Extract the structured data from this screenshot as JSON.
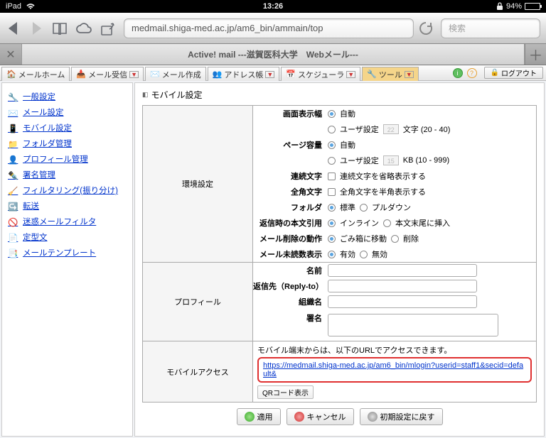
{
  "ios": {
    "device": "iPad",
    "time": "13:26",
    "battery": "94%"
  },
  "browser": {
    "url": "medmail.shiga-med.ac.jp/am6_bin/ammain/top",
    "searchPlaceholder": "検索",
    "tab": "Active! mail ---滋賀医科大学　Webメール---"
  },
  "toolbar": {
    "tabs": [
      "メールホーム",
      "メール受信",
      "メール作成",
      "アドレス帳",
      "スケジューラ",
      "ツール"
    ],
    "logout": "ログアウト"
  },
  "sidebar": [
    "一般設定",
    "メール設定",
    "モバイル設定",
    "フォルダ管理",
    "プロフィール管理",
    "署名管理",
    "フィルタリング(振り分け)",
    "転送",
    "迷惑メールフィルタ",
    "定型文",
    "メールテンプレート"
  ],
  "content": {
    "title": "モバイル設定",
    "env_section": "環境設定",
    "profile_section": "プロフィール",
    "mobile_section": "モバイルアクセス",
    "env": {
      "width_label": "画面表示幅",
      "width_auto": "自動",
      "width_user": "ユーザ設定",
      "width_unit": "文字 (20 - 40)",
      "width_box": "22",
      "page_label": "ページ容量",
      "page_auto": "自動",
      "page_user": "ユーザ設定",
      "page_unit": "KB (10 - 999)",
      "page_box": "15",
      "cont_label": "連続文字",
      "cont_text": "連続文字を省略表示する",
      "full_label": "全角文字",
      "full_text": "全角文字を半角表示する",
      "folder_label": "フォルダ",
      "folder_std": "標準",
      "folder_pd": "プルダウン",
      "quote_label": "返信時の本文引用",
      "quote_inline": "インライン",
      "quote_end": "本文末尾に挿入",
      "del_label": "メール削除の動作",
      "del_trash": "ごみ箱に移動",
      "del_now": "削除",
      "unread_label": "メール未読数表示",
      "unread_on": "有効",
      "unread_off": "無効"
    },
    "profile": {
      "name_label": "名前",
      "reply_label": "返信先（Reply-to）",
      "org_label": "組織名",
      "sig_label": "署名"
    },
    "mobile": {
      "note": "モバイル端末からは、以下のURLでアクセスできます。",
      "url": "https://medmail.shiga-med.ac.jp/am6_bin/mlogin?userid=staff1&secid=default&",
      "qr": "QRコード表示"
    },
    "actions": {
      "apply": "適用",
      "cancel": "キャンセル",
      "reset": "初期設定に戻す"
    }
  }
}
